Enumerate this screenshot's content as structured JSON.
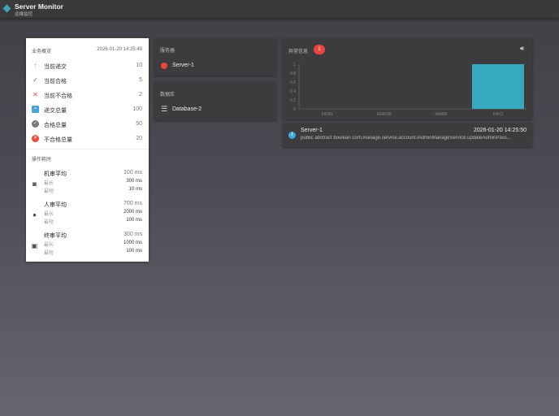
{
  "header": {
    "title": "Server Monitor",
    "subtitle": "运维监控"
  },
  "business": {
    "title": "业务概览",
    "timestamp": "2026-01-20 14:25:49",
    "items": [
      {
        "label": "当前递交",
        "value": "10",
        "icon": "arrow-up-icon"
      },
      {
        "label": "当前合格",
        "value": "5",
        "icon": "check-icon"
      },
      {
        "label": "当前不合格",
        "value": "2",
        "icon": "close-icon"
      },
      {
        "label": "递交总量",
        "value": "100",
        "icon": "inbox-icon"
      },
      {
        "label": "合格总量",
        "value": "50",
        "icon": "check-circle-icon"
      },
      {
        "label": "不合格总量",
        "value": "20",
        "icon": "cancel-circle-icon"
      }
    ]
  },
  "ops": {
    "title": "操作耗时",
    "max_label": "最长",
    "min_label": "最短",
    "items": [
      {
        "name": "机审平均",
        "avg": "100 ms",
        "max": "300 ms",
        "min": "10 ms",
        "icon": "robot-icon"
      },
      {
        "name": "人审平均",
        "avg": "700 ms",
        "max": "2000 ms",
        "min": "100 ms",
        "icon": "person-icon"
      },
      {
        "name": "终审平均",
        "avg": "300 ms",
        "max": "1000 ms",
        "min": "100 ms",
        "icon": "account-box-icon"
      }
    ]
  },
  "servers": {
    "title": "服务器",
    "items": [
      {
        "name": "Server-1",
        "status_color": "#e8453c"
      }
    ]
  },
  "databases": {
    "title": "数据库",
    "items": [
      {
        "name": "Database-2"
      }
    ]
  },
  "alerts": {
    "title": "异常信息",
    "badge": "1",
    "events": [
      {
        "source": "Server-1",
        "time": "2026-01-20 14:25:50",
        "message": "public abstract boolean com.manage.service.account.IAdminManageService.updateAdminPass..."
      }
    ]
  },
  "chart_data": {
    "type": "bar",
    "categories": [
      "FATAL",
      "ERROR",
      "WARN",
      "INFO"
    ],
    "values": [
      0,
      0,
      0,
      1
    ],
    "ylim": [
      0,
      1
    ],
    "yticks": [
      "0",
      "0.2",
      "0.4",
      "0.6",
      "0.8",
      "1"
    ],
    "color": "#35a9bd"
  }
}
